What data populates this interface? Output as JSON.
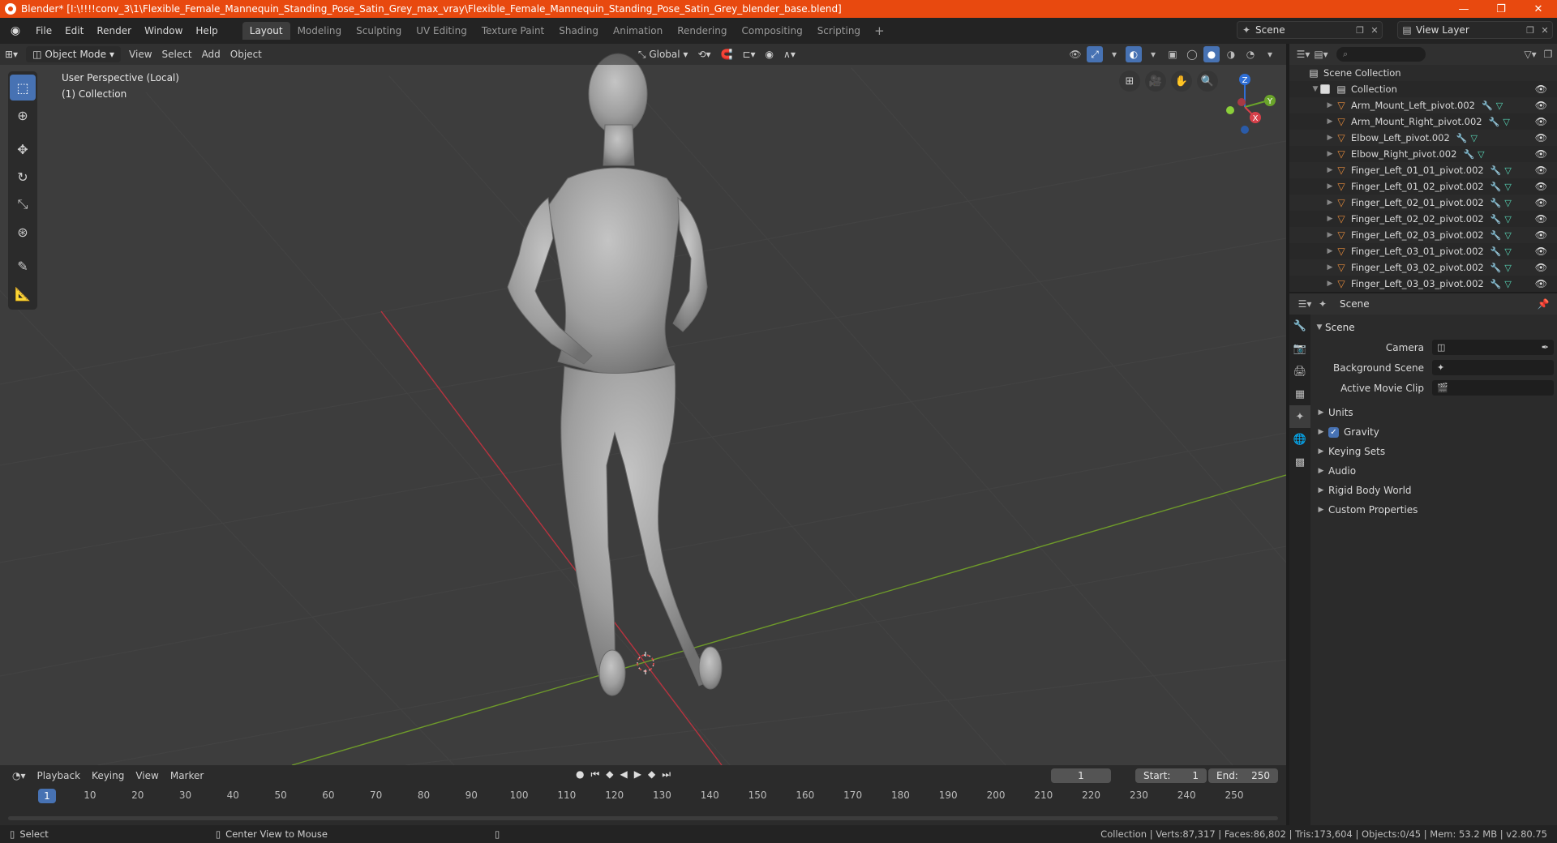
{
  "window": {
    "title": "Blender* [I:\\!!!!conv_3\\1\\Flexible_Female_Mannequin_Standing_Pose_Satin_Grey_max_vray\\Flexible_Female_Mannequin_Standing_Pose_Satin_Grey_blender_base.blend]",
    "controls": [
      "—",
      "❐",
      "✕"
    ]
  },
  "menu": [
    "File",
    "Edit",
    "Render",
    "Window",
    "Help"
  ],
  "workspaces": [
    "Layout",
    "Modeling",
    "Sculpting",
    "UV Editing",
    "Texture Paint",
    "Shading",
    "Animation",
    "Rendering",
    "Compositing",
    "Scripting"
  ],
  "active_workspace": "Layout",
  "scene_field": "Scene",
  "view_layer_field": "View Layer",
  "viewport": {
    "mode": "Object Mode",
    "menus": [
      "View",
      "Select",
      "Add",
      "Object"
    ],
    "orientation": "Global",
    "info_line1": "User Perspective (Local)",
    "info_line2": "(1) Collection",
    "axis_x": "X",
    "axis_y": "Y",
    "axis_z": "Z"
  },
  "outliner": {
    "scene_collection": "Scene Collection",
    "collection": "Collection",
    "objects": [
      "Arm_Mount_Left_pivot.002",
      "Arm_Mount_Right_pivot.002",
      "Elbow_Left_pivot.002",
      "Elbow_Right_pivot.002",
      "Finger_Left_01_01_pivot.002",
      "Finger_Left_01_02_pivot.002",
      "Finger_Left_02_01_pivot.002",
      "Finger_Left_02_02_pivot.002",
      "Finger_Left_02_03_pivot.002",
      "Finger_Left_03_01_pivot.002",
      "Finger_Left_03_02_pivot.002",
      "Finger_Left_03_03_pivot.002"
    ]
  },
  "properties": {
    "header": "Scene",
    "panel": "Scene",
    "camera_label": "Camera",
    "bg_scene_label": "Background Scene",
    "movie_clip_label": "Active Movie Clip",
    "sub_panels": [
      "Units",
      "Gravity",
      "Keying Sets",
      "Audio",
      "Rigid Body World",
      "Custom Properties"
    ]
  },
  "timeline": {
    "menus": [
      "Playback",
      "Keying",
      "View",
      "Marker"
    ],
    "current_frame": "1",
    "start_label": "Start:",
    "start": "1",
    "end_label": "End:",
    "end": "250",
    "ticks": [
      "1",
      "10",
      "20",
      "30",
      "40",
      "50",
      "60",
      "70",
      "80",
      "90",
      "100",
      "110",
      "120",
      "130",
      "140",
      "150",
      "160",
      "170",
      "180",
      "190",
      "200",
      "210",
      "220",
      "230",
      "240",
      "250"
    ]
  },
  "statusbar": {
    "select": "Select",
    "center_view": "Center View to Mouse",
    "stats": "Collection | Verts:87,317 | Faces:86,802 | Tris:173,604 | Objects:0/45 | Mem: 53.2 MB | v2.80.75"
  }
}
